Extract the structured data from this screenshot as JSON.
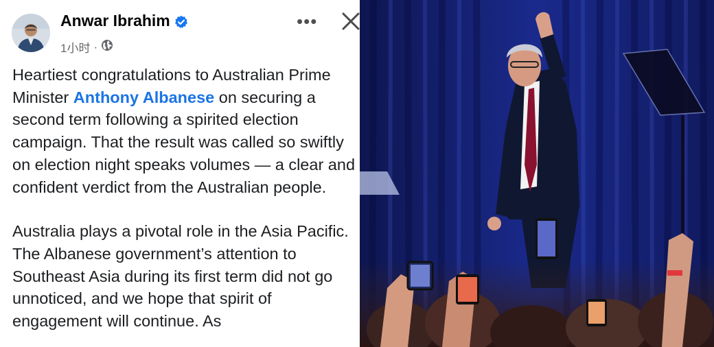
{
  "post": {
    "author": "Anwar Ibrahim",
    "timestamp": "1小时",
    "audience_icon": "globe-icon",
    "verified_icon": "verified-badge-icon",
    "more_label": "•••",
    "close_icon": "close-icon",
    "body": {
      "p1_before": "Heartiest congratulations to Australian Prime Minister ",
      "mention": "Anthony Albanese",
      "p1_after": " on securing a second term following a spirited election campaign. That the result was called so swiftly on election night speaks volumes — a clear and confident verdict from the Australian people.",
      "p2": "Australia plays a pivotal role in the Asia Pacific. The Albanese government’s attention to Southeast Asia during its first term did not go unnoticed, and we hope that spirit of engagement will continue. As"
    }
  },
  "colors": {
    "mention": "#1b74e4",
    "verified": "#1877f2",
    "meta": "#65676b"
  }
}
